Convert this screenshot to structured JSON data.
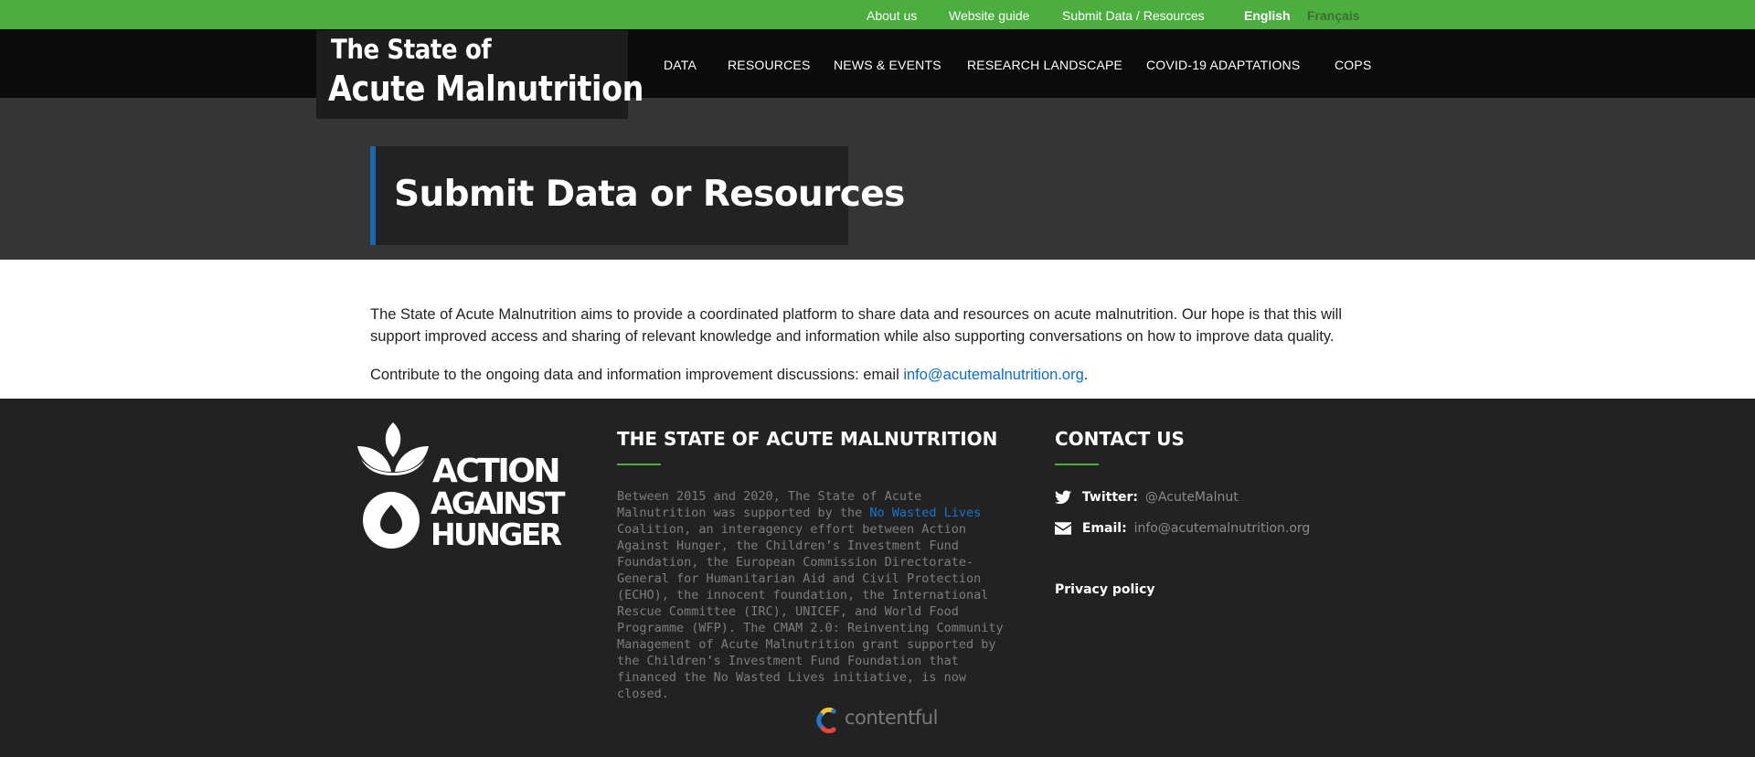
{
  "utility_nav": {
    "about": "About us",
    "guide": "Website guide",
    "submit": "Submit Data / Resources",
    "lang_en": "English",
    "lang_fr": "Français"
  },
  "logo": {
    "line1": "The State of",
    "line2": "Acute Malnutrition"
  },
  "main_nav": [
    "DATA",
    "RESOURCES",
    "NEWS & EVENTS",
    "RESEARCH LANDSCAPE",
    "COVID-19 ADAPTATIONS",
    "COPS"
  ],
  "hero": {
    "title": "Submit Data or Resources"
  },
  "content": {
    "paragraph1": "The State of Acute Malnutrition aims to provide a coordinated platform to share data and resources on acute malnutrition. Our hope is that this will support improved access and sharing of relevant knowledge and information while also supporting conversations on how to improve data quality.",
    "paragraph2_prefix": "Contribute to the ongoing data and information improvement discussions: email ",
    "email_link": "info@acutemalnutrition.org",
    "paragraph2_suffix": "."
  },
  "footer": {
    "partner_logo": [
      "ACTION",
      "AGAINST",
      "HUNGER"
    ],
    "about_heading": "THE STATE OF ACUTE MALNUTRITION",
    "about_text_1": "Between 2015 and 2020, The State of Acute Malnutrition was supported by the ",
    "about_link": "No Wasted Lives",
    "about_text_2": " Coalition, an interagency effort between Action Against Hunger, the Children’s Investment Fund Foundation, the European Commission Directorate-General for Humanitarian Aid and Civil Protection (ECHO), the innocent foundation, the International Rescue Committee (IRC), UNICEF, and World Food Programme (WFP). The CMAM 2.0: Reinventing Community Management of Acute Malnutrition grant supported by the Children’s Investment Fund Foundation that financed the No Wasted Lives initiative, is now closed.",
    "contact_heading": "CONTACT US",
    "twitter_label": "Twitter:",
    "twitter_handle": "@AcuteMalnut",
    "email_label": "Email:",
    "email_value": "info@acutemalnutrition.org",
    "privacy": "Privacy policy",
    "cms_logo": "contentful"
  },
  "colors": {
    "accent_green": "#4cae3e",
    "accent_blue": "#1767b5",
    "link_blue": "#0a6bd6",
    "nav_black": "#0b0b0b",
    "footer_bg": "#222222"
  },
  "icons": [
    "twitter-icon",
    "envelope-icon",
    "action-against-hunger-logo",
    "contentful-logo"
  ]
}
